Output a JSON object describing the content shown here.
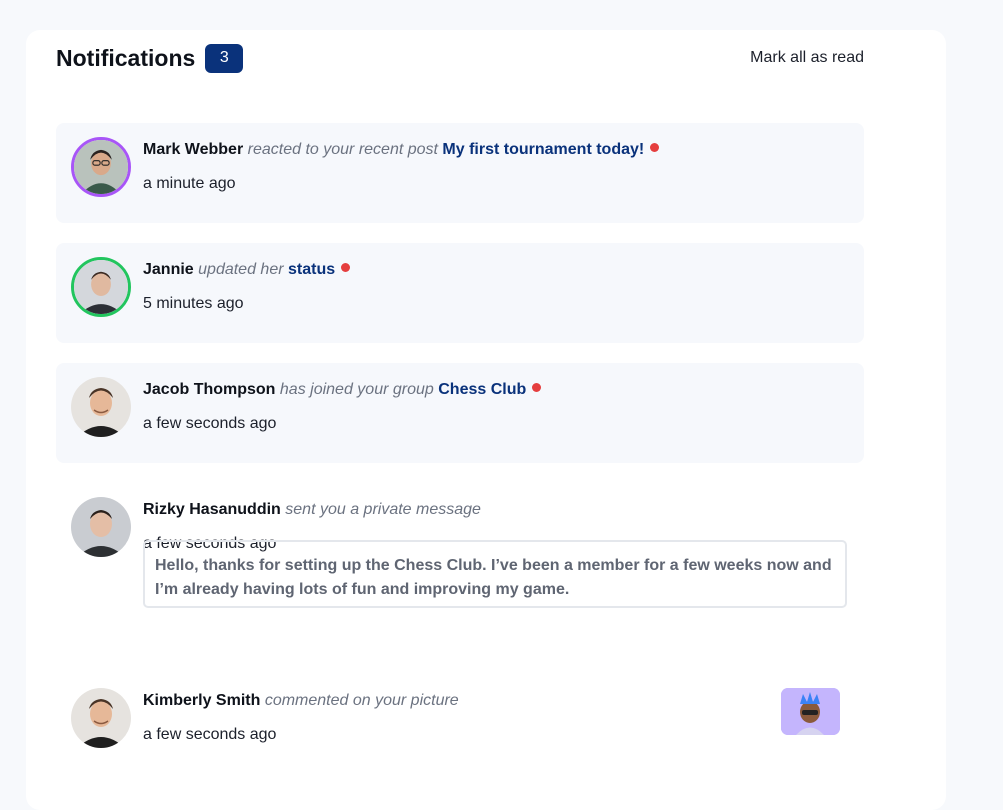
{
  "header": {
    "title": "Notifications",
    "unread_count": "3",
    "mark_all_label": "Mark all as read"
  },
  "notifications": [
    {
      "name": "Mark Webber",
      "action": "reacted to your recent post",
      "target": "My first tournament today!",
      "time": "a minute ago",
      "unread": true
    },
    {
      "name": "Jannie",
      "action": "updated her",
      "target": "status",
      "time": "5 minutes ago",
      "unread": true
    },
    {
      "name": "Jacob Thompson",
      "action": "has joined your group",
      "target": "Chess Club",
      "time": "a few seconds ago",
      "unread": true
    },
    {
      "name": "Rizky Hasanuddin",
      "action": "sent you a private message",
      "time": "a few seconds ago",
      "message": "Hello, thanks for setting up the Chess Club. I’ve been a member for a few weeks now and I’m already having lots of fun and improving my game.",
      "unread": false
    },
    {
      "name": "Kimberly Smith",
      "action": "commented on your picture",
      "time": "a few seconds ago",
      "unread": false
    }
  ],
  "colors": {
    "accent": "#0a327b",
    "unread_dot": "#e53e3e",
    "unread_bg": "#f6f8fc",
    "ring_purple": "#a855f7",
    "ring_green": "#22c55e"
  }
}
